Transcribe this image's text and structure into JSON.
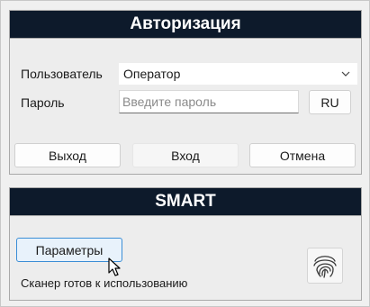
{
  "auth": {
    "title": "Авторизация",
    "user_label": "Пользователь",
    "user_value": "Оператор",
    "password_label": "Пароль",
    "password_placeholder": "Введите пароль",
    "lang_button": "RU",
    "exit_button": "Выход",
    "login_button": "Вход",
    "cancel_button": "Отмена"
  },
  "smart": {
    "title": "SMART",
    "params_button": "Параметры",
    "status_text": "Сканер готов к использованию",
    "scanner_icon": "fingerprint-icon"
  },
  "colors": {
    "header_bg": "#0d1a2b",
    "focus_border": "#3b8ed6"
  }
}
